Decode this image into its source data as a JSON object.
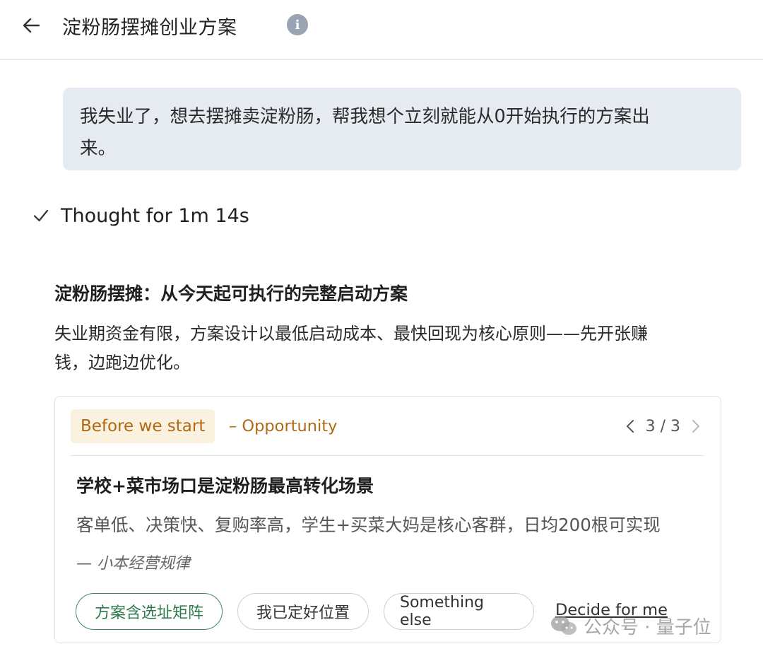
{
  "header": {
    "title": "淀粉肠摆摊创业方案",
    "back_icon": "arrow-left-icon",
    "info_icon": "info-icon",
    "info_glyph": "i"
  },
  "user_message": {
    "line1": "我失业了，想去摆摊卖淀粉肠，帮我想个立刻就能从0开始执行的方案出",
    "line2": "来。"
  },
  "thought": {
    "icon": "check-icon",
    "label": "Thought for 1m 14s"
  },
  "response": {
    "title": "淀粉肠摆摊：从今天起可执行的完整启动方案",
    "body_line1": "失业期资金有限，方案设计以最低启动成本、最快回现为核心原则——先开张赚",
    "body_line2": "钱，边跑边优化。"
  },
  "card": {
    "tag": "Before we start",
    "subtag": "– Opportunity",
    "pager": "3 / 3",
    "title": "学校+菜市场口是淀粉肠最高转化场景",
    "description": "客单低、决策快、复购率高，学生+买菜大妈是核心客群，日均200根可实现",
    "source": "— 小本经营规律",
    "options": [
      {
        "label": "方案含选址矩阵"
      },
      {
        "label": "我已定好位置"
      },
      {
        "label": "Something else"
      }
    ],
    "decide_link": "Decide for me"
  },
  "watermark": {
    "text": "公众号 · 量子位",
    "icon": "wechat-icon"
  },
  "colors": {
    "bubble_bg": "#e6ebf2",
    "tag_bg": "#fbf1df",
    "tag_text": "#b06a14",
    "chip_selected": "#2e7a4d"
  }
}
